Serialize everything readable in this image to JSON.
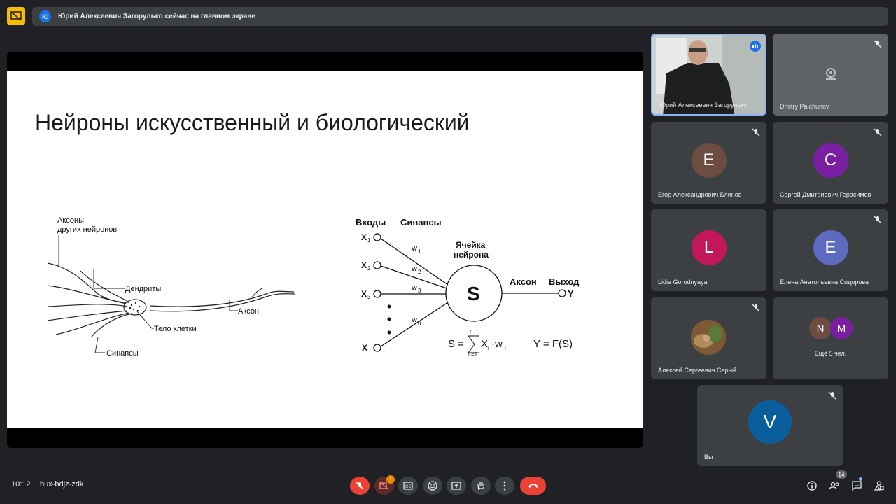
{
  "banner": {
    "avatar_letter": "Ю",
    "text": "Юрий Алексеевич Загорулько сейчас на главном экране"
  },
  "slide": {
    "title": "Нейроны искусственный и биологический",
    "bio": {
      "axons_label_1": "Аксоны",
      "axons_label_2": "других нейронов",
      "dendrites": "Дендриты",
      "axon": "Аксон",
      "cell_body": "Тело клетки",
      "synapses": "Синапсы"
    },
    "artificial": {
      "inputs": "Входы",
      "synapses": "Синапсы",
      "cell_1": "Ячейка",
      "cell_2": "нейрона",
      "axon": "Аксон",
      "output": "Выход",
      "x1": "X",
      "x2": "X",
      "x3": "X",
      "xn": "X",
      "sub1": "1",
      "sub2": "2",
      "sub3": "3",
      "w": "w",
      "s": "S",
      "y": "Y",
      "sum_left": "S =",
      "sum_top": "n",
      "sum_bottom": "i =1",
      "sum_right": "X",
      "sum_i": "i",
      "sum_w": "·w",
      "sum_wi": "i",
      "yfs": "Y = F(S)",
      "wn": "n"
    }
  },
  "participants": [
    {
      "name": "Юрий Алексеевич Загорулько",
      "type": "video"
    },
    {
      "name": "Dmitry Palchunov",
      "type": "no-camera"
    },
    {
      "name": "Егор Александрович Блинов",
      "letter": "E",
      "color": "#6d4c41"
    },
    {
      "name": "Сергей Дмитриевич Герасимов",
      "letter": "C",
      "color": "#7b1fa2"
    },
    {
      "name": "Lidia Gorodnyaya",
      "letter": "L",
      "color": "#c2185b"
    },
    {
      "name": "Елена Анатольевна Сидорова",
      "letter": "E",
      "color": "#5c6bc0"
    },
    {
      "name": "Алексей Сергеевич Серый",
      "type": "photo"
    },
    {
      "name": "Ещё 5 чел.",
      "letters": [
        "N",
        "M"
      ],
      "colors": [
        "#6d4c41",
        "#7b1fa2"
      ]
    },
    {
      "name": "Вы",
      "letter": "V",
      "color": "#0b5e9c"
    }
  ],
  "bottom": {
    "time": "10:12",
    "separator": "|",
    "meeting_code": "bux-bdjz-zdk",
    "camera_badge": "!",
    "people_count": "14"
  },
  "icons": [
    "present-icon",
    "mic-muted-icon",
    "camera-off-icon",
    "captions-icon",
    "emoji-icon",
    "present-screen-icon",
    "raise-hand-icon",
    "more-icon",
    "end-call-icon",
    "info-icon",
    "people-icon",
    "chat-icon",
    "activities-icon"
  ]
}
